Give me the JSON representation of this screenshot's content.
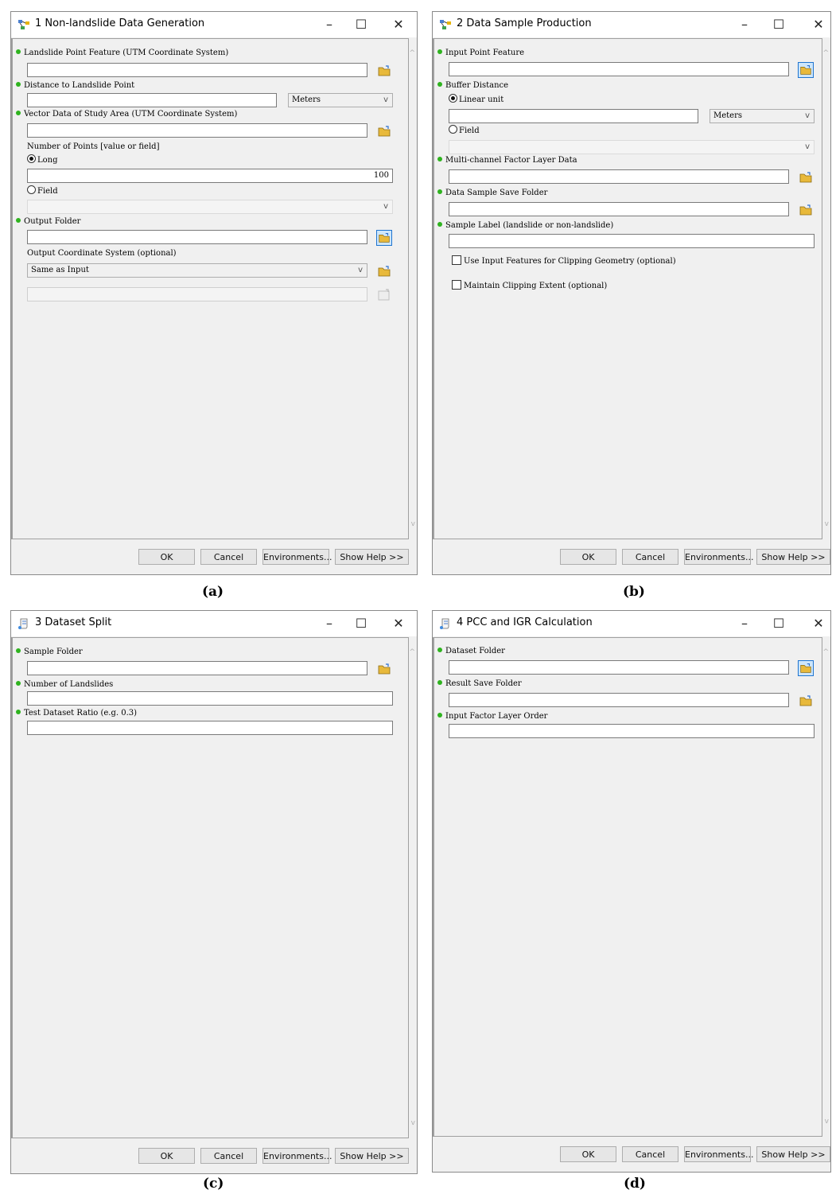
{
  "common": {
    "minimize": "–",
    "maximize": "☐",
    "close": "✕",
    "ok": "OK",
    "cancel": "Cancel",
    "environments": "Environments...",
    "show_help": "Show Help >>",
    "scroll_up": "^",
    "scroll_down": "v",
    "combo_arrow": "v"
  },
  "panel_a": {
    "caption": "(a)",
    "title": "1 Non-landslide Data Generation",
    "icon": "model-icon",
    "landslide_point_label": "Landslide Point Feature (UTM Coordinate System)",
    "distance_label": "Distance to Landslide Point",
    "distance_unit": "Meters",
    "vector_data_label": "Vector Data of Study Area (UTM Coordinate System)",
    "num_points_label": "Number of Points [value or field]",
    "radio_long": "Long",
    "long_value": "100",
    "radio_field": "Field",
    "output_folder_label": "Output Folder",
    "output_cs_label": "Output Coordinate System (optional)",
    "output_cs_value": "Same as Input"
  },
  "panel_b": {
    "caption": "(b)",
    "title": "2 Data Sample Production",
    "icon": "model-icon",
    "input_point_label": "Input Point Feature",
    "buffer_distance_label": "Buffer Distance",
    "radio_linear": "Linear unit",
    "linear_unit": "Meters",
    "radio_field": "Field",
    "factor_layer_label": "Multi-channel Factor Layer Data",
    "save_folder_label": "Data Sample Save Folder",
    "sample_label_label": "Sample Label (landslide or non-landslide)",
    "clip_geometry": "Use Input Features for Clipping Geometry (optional)",
    "clip_extent": "Maintain Clipping Extent (optional)"
  },
  "panel_c": {
    "caption": "(c)",
    "title": "3 Dataset Split",
    "icon": "script-icon",
    "sample_folder_label": "Sample Folder",
    "num_landslides_label": "Number of Landslides",
    "test_ratio_label": "Test Dataset Ratio (e.g. 0.3)"
  },
  "panel_d": {
    "caption": "(d)",
    "title": "4 PCC and IGR Calculation",
    "icon": "script-icon",
    "dataset_folder_label": "Dataset Folder",
    "result_folder_label": "Result Save Folder",
    "factor_order_label": "Input Factor Layer Order"
  },
  "colors": {
    "required_dot": "#2fb31f",
    "folder_icon": "#e8b93b",
    "selected_border": "#1e74d0"
  }
}
